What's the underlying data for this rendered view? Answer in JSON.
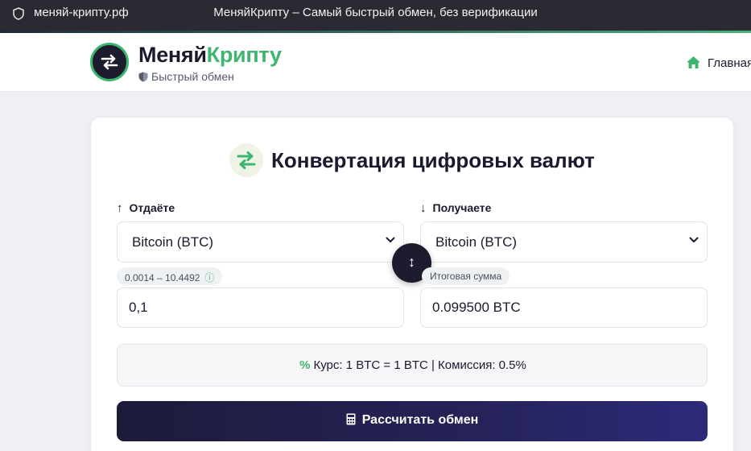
{
  "browser": {
    "url": "меняй-крипту.рф",
    "title": "МеняйКрипту – Самый быстрый обмен, без верификации"
  },
  "header": {
    "brand_part1": "Меняй",
    "brand_part2": "Крипту",
    "tagline": "Быстрый обмен",
    "nav_home": "Главная"
  },
  "converter": {
    "title": "Конвертация цифровых валют",
    "give": {
      "label": "Отдаёте",
      "currency": "Bitcoin (BTC)",
      "range": "0.0014 – 10.4492",
      "amount": "0,1"
    },
    "receive": {
      "label": "Получаете",
      "currency": "Bitcoin (BTC)",
      "result_label": "Итоговая сумма",
      "amount": "0.099500 BTC"
    },
    "rate_text": "Курс: 1 BTC = 1 BTC | Комиссия: 0.5%",
    "calculate_button": "Рассчитать обмен"
  },
  "colors": {
    "accent_green": "#3fb56f",
    "dark_navy": "#1c1c2e",
    "button_gradient_end": "#2d2a7a"
  },
  "icons": [
    "shield-icon",
    "exchange-arrows-icon",
    "home-icon",
    "arrow-up-icon",
    "arrow-down-icon",
    "chevron-down-icon",
    "swap-vertical-icon",
    "info-icon",
    "percent-icon",
    "calculator-icon"
  ]
}
